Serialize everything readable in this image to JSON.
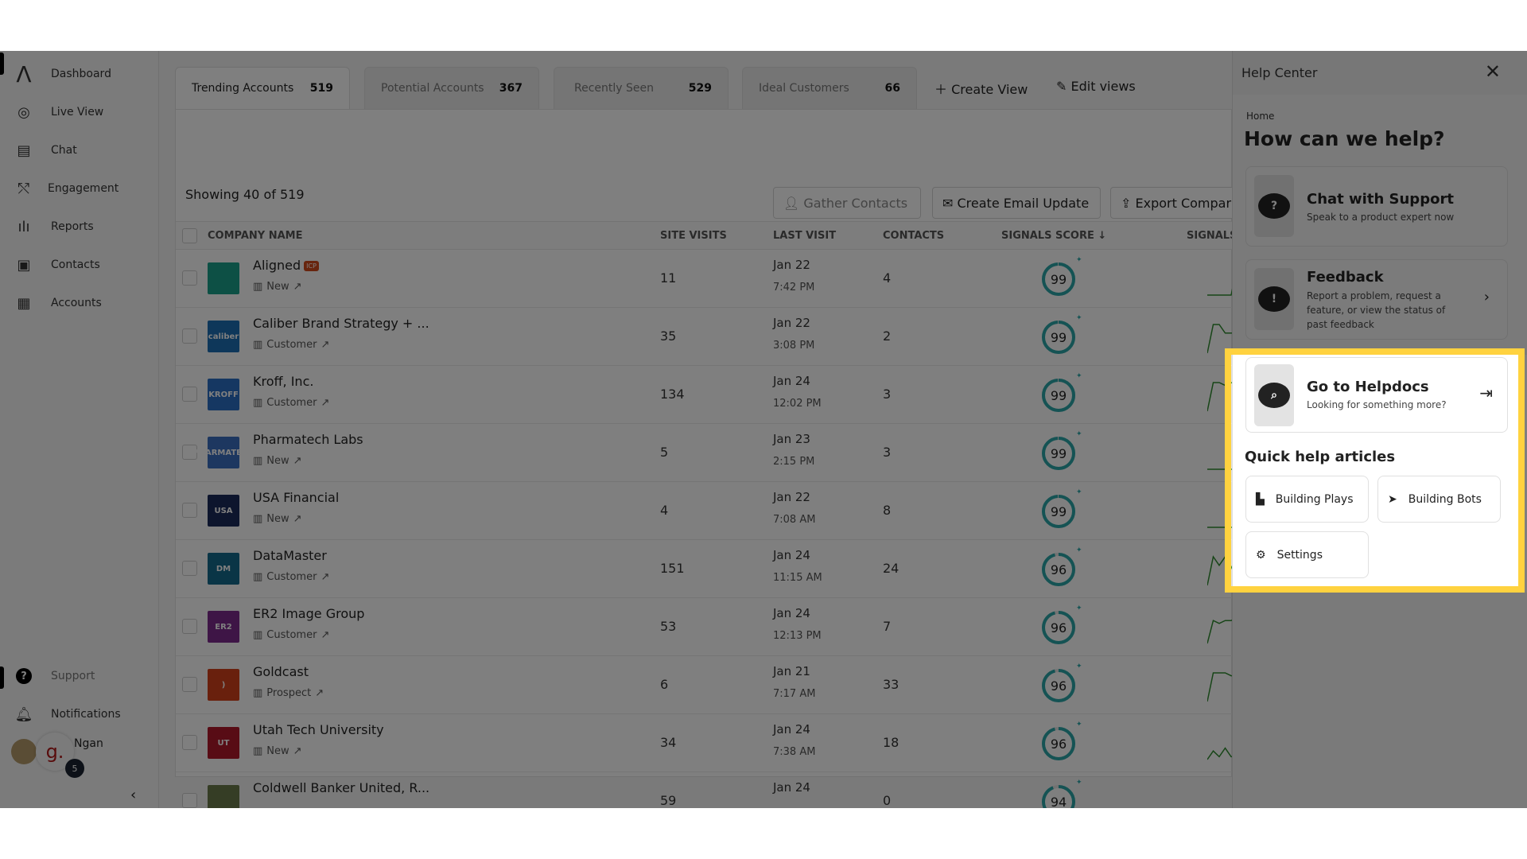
{
  "sidebar": {
    "items": [
      {
        "label": "Dashboard",
        "icon": "logo-icon"
      },
      {
        "label": "Live View",
        "icon": "live-view-icon"
      },
      {
        "label": "Chat",
        "icon": "chat-icon"
      },
      {
        "label": "Engagement",
        "icon": "engagement-icon"
      },
      {
        "label": "Reports",
        "icon": "reports-icon"
      },
      {
        "label": "Contacts",
        "icon": "contacts-icon"
      },
      {
        "label": "Accounts",
        "icon": "accounts-icon"
      }
    ],
    "support": "Support",
    "notifications": "Notifications",
    "user_name": "Ngan",
    "badge_count": "5",
    "workspace_letter": "g."
  },
  "tabs": [
    {
      "label": "Trending Accounts",
      "count": "519"
    },
    {
      "label": "Potential Accounts",
      "count": "367"
    },
    {
      "label": "Recently Seen",
      "count": "529"
    },
    {
      "label": "Ideal Customers",
      "count": "66"
    }
  ],
  "create_view": "Create View",
  "edit_views": "Edit views",
  "showing": "Showing 40 of  519",
  "actions": {
    "gather": "Gather Contacts",
    "email": "Create Email Update",
    "export": "Export Compar"
  },
  "columns": {
    "company": "COMPANY NAME",
    "visits": "SITE VISITS",
    "last": "LAST VISIT",
    "contacts": "CONTACTS",
    "score": "SIGNALS SCORE ↓",
    "signals": "SIGNALS"
  },
  "rows": [
    {
      "name": "Aligned",
      "icp": "ICP",
      "type": "New",
      "visits": "11",
      "date": "Jan 22",
      "time": "7:42 PM",
      "contacts": "4",
      "score": 99,
      "logo": "",
      "logo_color": "#1aa08a",
      "spark": [
        0,
        0,
        0,
        0,
        0,
        10,
        10,
        10,
        10
      ]
    },
    {
      "name": "Caliber Brand Strategy + ...",
      "type": "Customer",
      "visits": "35",
      "date": "Jan 22",
      "time": "3:08 PM",
      "contacts": "2",
      "score": 99,
      "logo": "caliber",
      "logo_color": "#1c6fb5",
      "spark": [
        0,
        10,
        10,
        7,
        7,
        7,
        10,
        10,
        10
      ]
    },
    {
      "name": "Kroff, Inc.",
      "type": "Customer",
      "visits": "134",
      "date": "Jan 24",
      "time": "12:02 PM",
      "contacts": "3",
      "score": 99,
      "logo": "KROFF",
      "logo_color": "#2a6fc4",
      "spark": [
        0,
        10,
        10,
        9,
        10,
        9,
        10,
        10,
        10
      ]
    },
    {
      "name": "Pharmatech Labs",
      "type": "New",
      "visits": "5",
      "date": "Jan 23",
      "time": "2:15 PM",
      "contacts": "3",
      "score": 99,
      "logo": "PHARMATECH",
      "logo_color": "#3b6fc0",
      "spark": [
        0,
        0,
        0,
        0,
        0,
        0,
        0,
        0,
        0
      ]
    },
    {
      "name": "USA Financial",
      "type": "New",
      "visits": "4",
      "date": "Jan 22",
      "time": "7:08 AM",
      "contacts": "8",
      "score": 99,
      "logo": "USA",
      "logo_color": "#1b2a5a",
      "spark": [
        0,
        0,
        0,
        0,
        0,
        0,
        0,
        0,
        0
      ]
    },
    {
      "name": "DataMaster",
      "type": "Customer",
      "visits": "151",
      "date": "Jan 24",
      "time": "11:15 AM",
      "contacts": "24",
      "score": 96,
      "logo": "DM",
      "logo_color": "#146a8c",
      "spark": [
        0,
        10,
        7,
        10,
        6,
        10,
        9,
        10,
        10
      ]
    },
    {
      "name": "ER2 Image Group",
      "type": "Customer",
      "visits": "53",
      "date": "Jan 24",
      "time": "12:13 PM",
      "contacts": "7",
      "score": 96,
      "logo": "ER2",
      "logo_color": "#7d2a8c",
      "spark": [
        0,
        8,
        7,
        8,
        8,
        9,
        9,
        10,
        9
      ]
    },
    {
      "name": "Goldcast",
      "type": "Prospect",
      "visits": "6",
      "date": "Jan 21",
      "time": "7:17 AM",
      "contacts": "33",
      "score": 96,
      "logo": ")",
      "logo_color": "#d2401a",
      "spark": [
        0,
        10,
        10,
        10,
        9,
        9,
        9,
        9,
        9
      ]
    },
    {
      "name": "Utah Tech University",
      "type": "New",
      "visits": "34",
      "date": "Jan 24",
      "time": "7:38 AM",
      "contacts": "18",
      "score": 96,
      "logo": "UT",
      "logo_color": "#b0182a",
      "spark": [
        0,
        3,
        1,
        4,
        1,
        1,
        10,
        8,
        7
      ]
    },
    {
      "name": "Coldwell Banker United, R...",
      "type": "",
      "visits": "59",
      "date": "Jan 24",
      "time": "",
      "contacts": "0",
      "score": 94,
      "logo": "",
      "logo_color": "#6b7a4a",
      "spark": []
    }
  ],
  "help": {
    "title": "Help Center",
    "breadcrumb": "Home",
    "heading": "How can we help?",
    "chat": {
      "title": "Chat with Support",
      "sub": "Speak to a product expert now"
    },
    "feedback": {
      "title": "Feedback",
      "sub": "Report a problem, request a feature, or view the status of past feedback"
    },
    "helpdocs": {
      "title": "Go to Helpdocs",
      "sub": "Looking for something more?"
    },
    "quick_title": "Quick help articles",
    "quick": [
      "Building Plays",
      "Building Bots",
      "Settings"
    ]
  },
  "colors": {
    "score_ring": "#2aa6a8",
    "spark": "#2f8a2f",
    "highlight": "#ffd23f"
  }
}
